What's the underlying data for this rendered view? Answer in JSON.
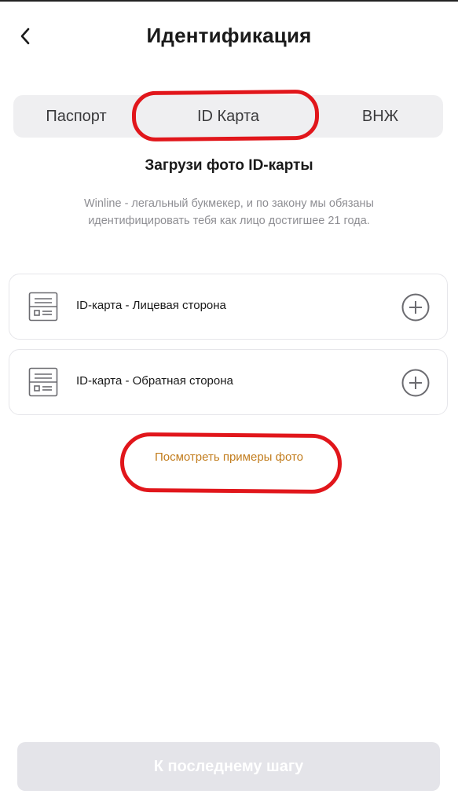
{
  "header": {
    "title": "Идентификация",
    "back_icon": "chevron-left-icon"
  },
  "tabs": [
    {
      "label": "Паспорт",
      "selected": false
    },
    {
      "label": "ID Карта",
      "selected": true
    },
    {
      "label": "ВНЖ",
      "selected": false
    }
  ],
  "main": {
    "section_title": "Загрузи фото ID-карты",
    "description": "Winline - легальный букмекер, и по закону мы обязаны идентифицировать тебя как лицо достигшее 21 года.",
    "uploads": [
      {
        "label": "ID-карта - Лицевая сторона",
        "icon": "document-icon",
        "action_icon": "plus-circle-icon"
      },
      {
        "label": "ID-карта - Обратная сторона",
        "icon": "document-icon",
        "action_icon": "plus-circle-icon"
      }
    ],
    "examples_link": "Посмотреть примеры фото"
  },
  "footer": {
    "next_button": "К последнему шагу",
    "enabled": false
  },
  "colors": {
    "accent_link": "#c27d1e",
    "annotation": "#e1161b",
    "disabled_button": "#e4e4e9",
    "tabs_background": "#efeff1"
  }
}
